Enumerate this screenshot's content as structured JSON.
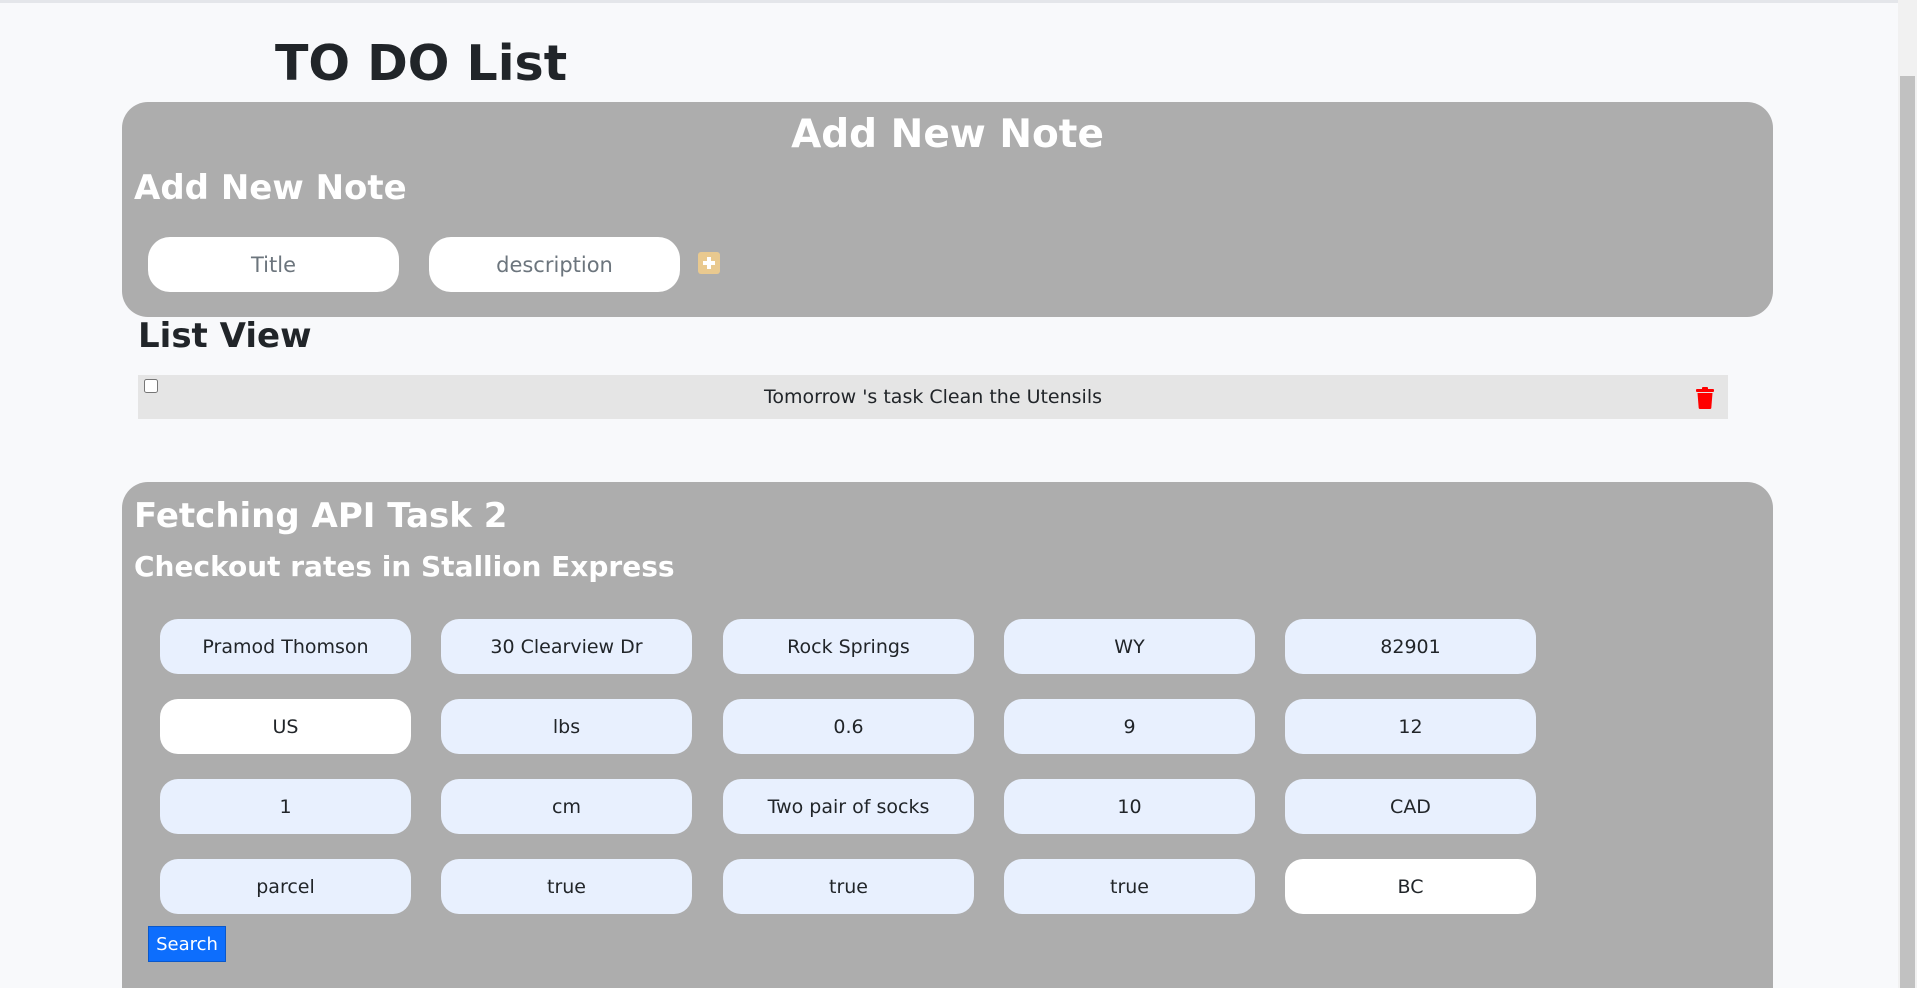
{
  "app": {
    "title": "TO DO List"
  },
  "add_note": {
    "heading_center": "Add New Note",
    "heading_left": "Add New Note",
    "title_placeholder": "Title",
    "description_placeholder": "description",
    "add_icon": "plus-square-icon",
    "add_icon_color": "#e9c98f"
  },
  "list_view": {
    "heading": "List View",
    "items": [
      {
        "text": "Tomorrow 's task Clean the Utensils",
        "checked": false
      }
    ],
    "delete_icon": "trash-icon",
    "delete_icon_color": "#ff0000"
  },
  "api_task": {
    "title": "Fetching API Task 2",
    "subtitle": "Checkout rates in Stallion Express",
    "fields": [
      "Pramod Thomson",
      "30 Clearview Dr",
      "Rock Springs",
      "WY",
      "82901",
      "US",
      "lbs",
      "0.6",
      "9",
      "12",
      "1",
      "cm",
      "Two pair of socks",
      "10",
      "CAD",
      "parcel",
      "true",
      "true",
      "true",
      "BC"
    ],
    "search_label": "Search"
  },
  "colors": {
    "panel_bg": "#adadad",
    "autofill_bg": "#e8f0fe",
    "primary": "#0d6efd"
  }
}
